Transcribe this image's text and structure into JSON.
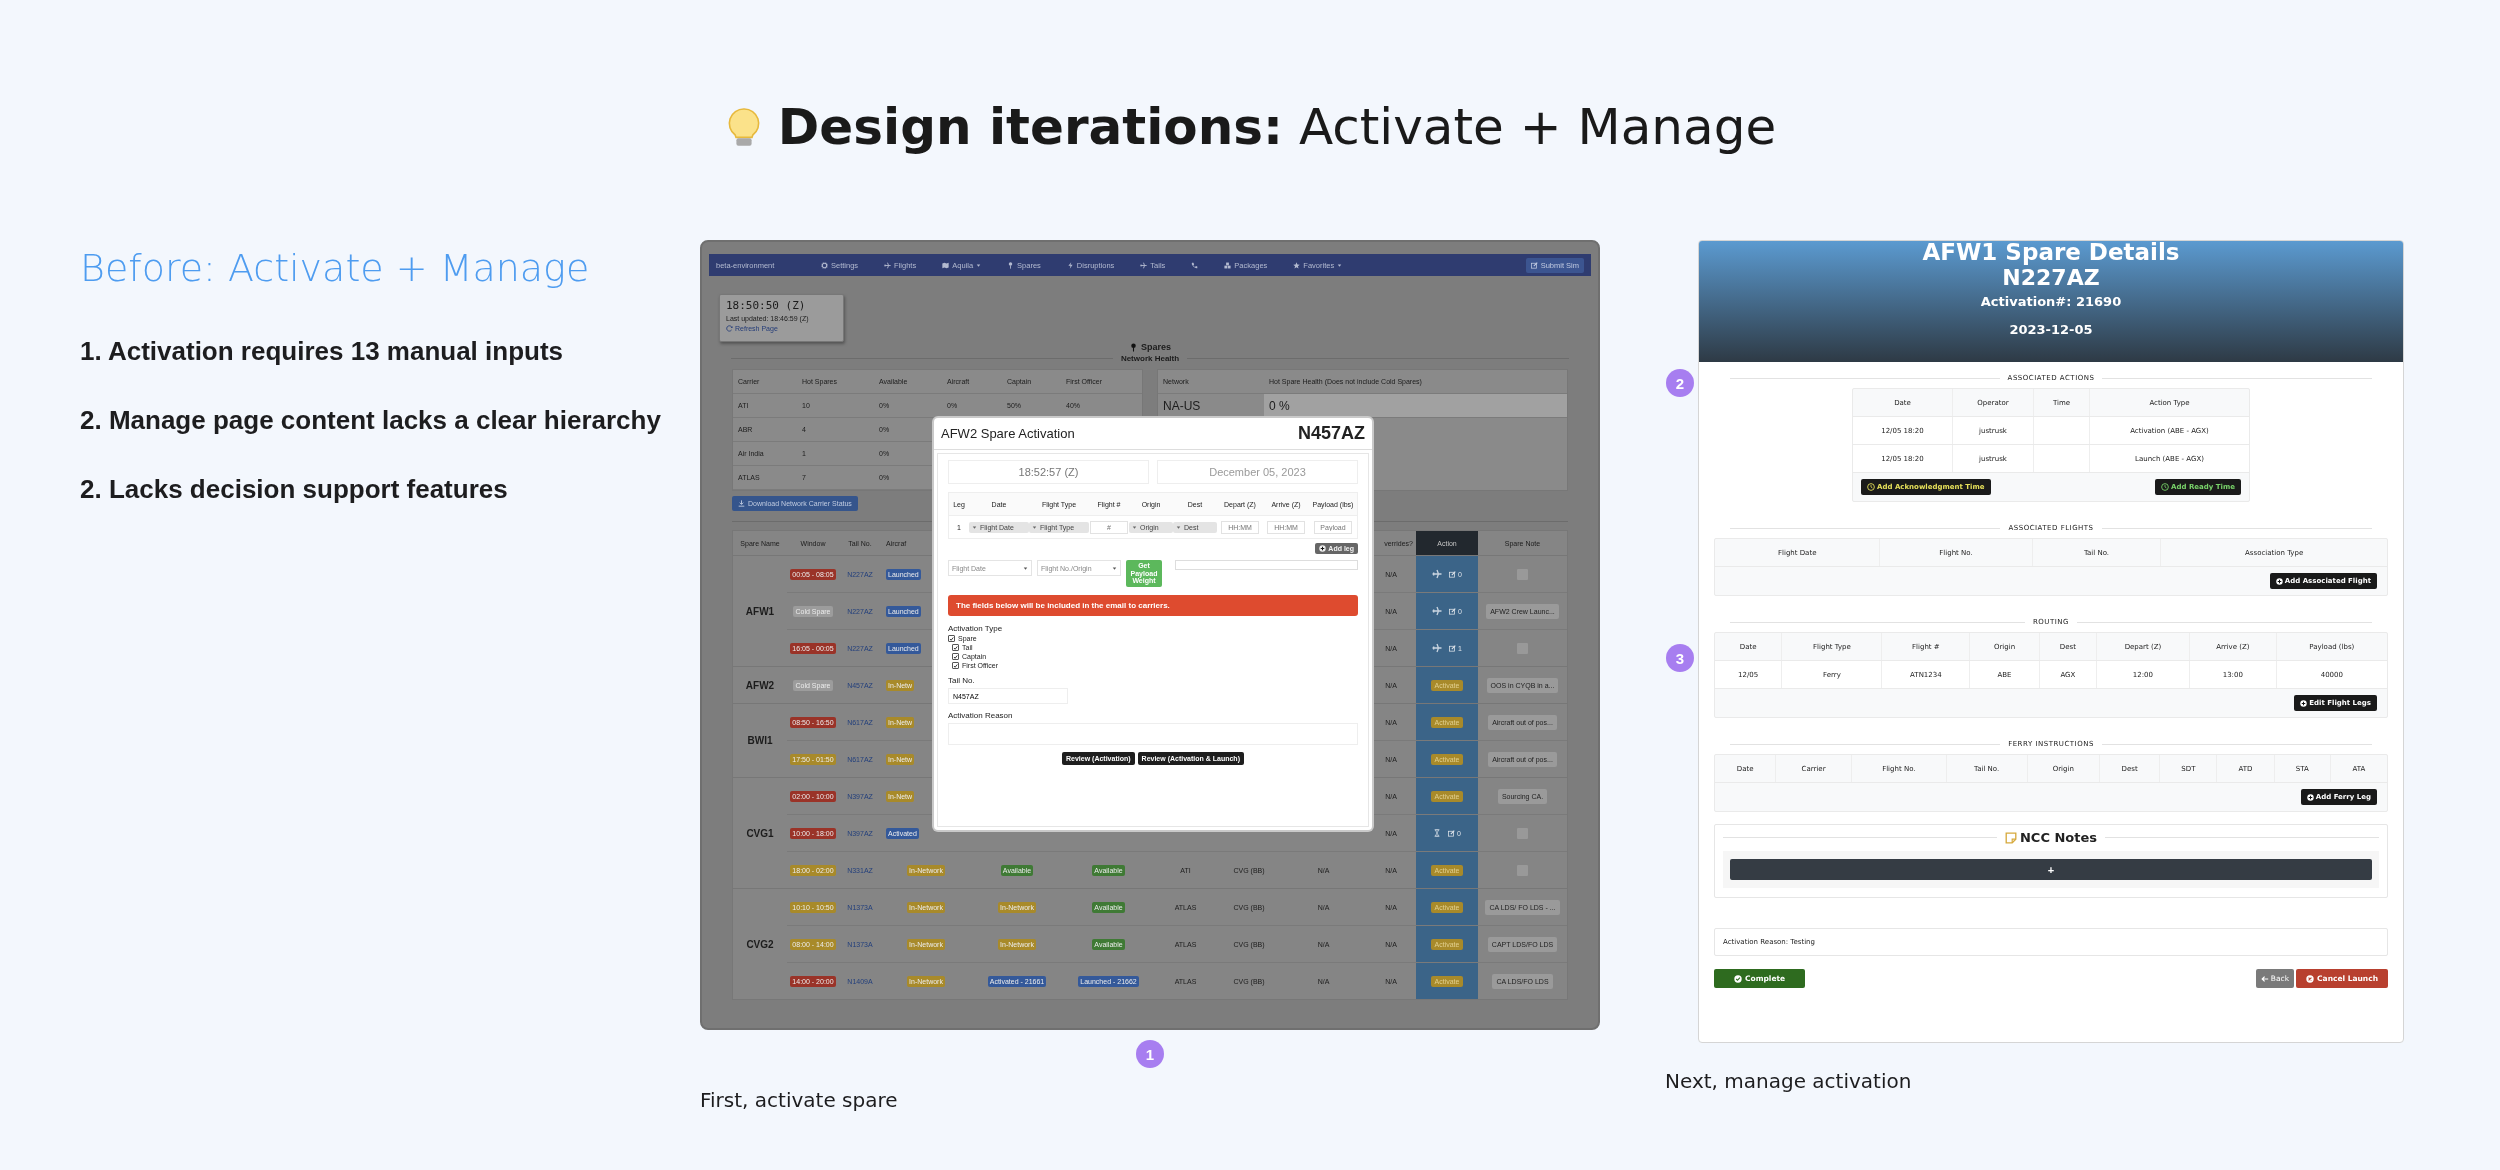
{
  "title": "**Design iterations:** Activate + Manage",
  "before": {
    "heading": "Before: Activate + Manage",
    "points": [
      "1. Activation requires 13 manual inputs",
      "2. Manage page content lacks a clear hierarchy",
      "2. Lacks decision support features"
    ]
  },
  "figure_1": {
    "badge": "1",
    "caption": "First, activate spare",
    "app": {
      "navbar": {
        "brand": "beta-environment",
        "items": [
          {
            "kind": "link",
            "label": "Settings"
          },
          {
            "kind": "link",
            "label": "Flights"
          },
          {
            "kind": "link",
            "label": "Aquila",
            "dropdown": true
          },
          {
            "kind": "link",
            "label": "Spares"
          },
          {
            "kind": "link",
            "label": "Disruptions"
          },
          {
            "kind": "link",
            "label": "Tails"
          },
          {
            "kind": "icon"
          },
          {
            "kind": "link",
            "label": "Packages"
          },
          {
            "kind": "link",
            "label": "Favorites",
            "dropdown": true
          }
        ],
        "submit": "Submit Sim"
      },
      "clock": {
        "time": "18:50:50 (Z)",
        "updated": "Last updated: 18:46:59 (Z)",
        "refresh": "Refresh Page"
      },
      "page_title": "Spares",
      "network_health": "Network Health",
      "carrier_table": {
        "columns": [
          "Carrier",
          "Hot Spares",
          "Available",
          "Aircraft",
          "Captain",
          "First Officer"
        ],
        "rows": [
          [
            "ATI",
            "10",
            "0%",
            "0%",
            "50%",
            "40%"
          ],
          [
            "ABR",
            "4",
            "0%"
          ],
          [
            "Air India",
            "1",
            "0%"
          ],
          [
            "ATLAS",
            "7",
            "0%"
          ]
        ]
      },
      "network_table": {
        "columns": [
          "Network",
          "Hot Spare Health"
        ],
        "note": "(Does not include Cold Spares)",
        "rows": [
          [
            "NA-US",
            "0 %"
          ]
        ]
      },
      "download_button": "Download Network Carrier Status",
      "spares_table": {
        "columns_left": [
          "Spare Name",
          "Window",
          "Tail No.",
          "Aircraf"
        ],
        "columns_right": [
          "verrides?",
          "Action",
          "Spare Note"
        ],
        "groups": [
          {
            "name": "AFW1",
            "rows": [
              {
                "window": {
                  "text": "00:05 - 08:05",
                  "color": "#9a3328"
                },
                "tail": "N227AZ",
                "aircraft": {
                  "text": "Launched",
                  "color": "#34599a"
                },
                "overrides": "N/A",
                "action": {
                  "kind": "plane",
                  "count": "0"
                },
                "note": {
                  "kind": "checkbox",
                  "checked": false
                }
              },
              {
                "window": {
                  "text": "Cold Spare",
                  "color": "#9c9c9c"
                },
                "tail": "N227AZ",
                "aircraft": {
                  "text": "Launched",
                  "color": "#34599a"
                },
                "overrides": "N/A",
                "action": {
                  "kind": "plane",
                  "count": "0"
                },
                "note": {
                  "kind": "text",
                  "text": "AFW2 Crew Launc..."
                }
              },
              {
                "window": {
                  "text": "16:05 - 00:05",
                  "color": "#9a3328"
                },
                "tail": "N227AZ",
                "aircraft": {
                  "text": "Launched",
                  "color": "#34599a"
                },
                "overrides": "N/A",
                "action": {
                  "kind": "plane",
                  "count": "1"
                },
                "note": {
                  "kind": "checkbox",
                  "checked": false
                }
              }
            ]
          },
          {
            "name": "AFW2",
            "rows": [
              {
                "window": {
                  "text": "Cold Spare",
                  "color": "#9c9c9c"
                },
                "tail": "N457AZ",
                "aircraft": {
                  "text": "In-Netw",
                  "color": "#a88a2a"
                },
                "overrides": "N/A",
                "action": {
                  "kind": "activate",
                  "label": "Activate"
                },
                "note": {
                  "kind": "text",
                  "text": "OOS in CYQB in a..."
                }
              }
            ]
          },
          {
            "name": "BWI1",
            "rows": [
              {
                "window": {
                  "text": "08:50 - 16:50",
                  "color": "#9a3328"
                },
                "tail": "N617AZ",
                "aircraft": {
                  "text": "In-Netw",
                  "color": "#a88a2a"
                },
                "overrides": "N/A",
                "action": {
                  "kind": "activate",
                  "label": "Activate"
                },
                "note": {
                  "kind": "text",
                  "text": "Aircraft out of pos..."
                }
              },
              {
                "window": {
                  "text": "17:50 - 01:50",
                  "color": "#a88a2a"
                },
                "tail": "N617AZ",
                "aircraft": {
                  "text": "In-Netw",
                  "color": "#a88a2a"
                },
                "overrides": "N/A",
                "action": {
                  "kind": "activate",
                  "label": "Activate"
                },
                "note": {
                  "kind": "text",
                  "text": "Aircraft out of pos..."
                }
              }
            ]
          },
          {
            "name": "CVG1",
            "rows": [
              {
                "window": {
                  "text": "02:00 - 10:00",
                  "color": "#9a3328"
                },
                "tail": "N397AZ",
                "aircraft": {
                  "text": "In-Netw",
                  "color": "#a88a2a"
                },
                "overrides": "N/A",
                "action": {
                  "kind": "activate",
                  "label": "Activate"
                },
                "note": {
                  "kind": "text",
                  "text": "Sourcing CA."
                }
              },
              {
                "window": {
                  "text": "10:00 - 18:00",
                  "color": "#9a3328"
                },
                "tail": "N397AZ",
                "aircraft": {
                  "text": "Activated",
                  "color": "#34599a"
                },
                "overrides": "N/A",
                "action": {
                  "kind": "pending",
                  "count": "0"
                },
                "note": {
                  "kind": "checkbox",
                  "checked": false
                }
              },
              {
                "window": {
                  "text": "18:00 - 02:00",
                  "color": "#a88a2a"
                },
                "tail": "N331AZ",
                "aircraft": {
                  "text": "In-Network",
                  "color": "#a88a2a"
                },
                "column_5": {
                  "text": "Available",
                  "color": "#3f7a35"
                },
                "column_6": {
                  "text": "Available",
                  "color": "#3f7a35"
                },
                "column_7": "ATI",
                "column_8": "CVG (BB)",
                "column_9": "N/A",
                "overrides": "N/A",
                "action": {
                  "kind": "activate",
                  "label": "Activate"
                },
                "note": {
                  "kind": "checkbox",
                  "checked": false
                }
              }
            ]
          },
          {
            "name": "CVG2",
            "rows": [
              {
                "window": {
                  "text": "10:10 - 10:50",
                  "color": "#a88a2a"
                },
                "tail": "N1373A",
                "aircraft": {
                  "text": "In-Network",
                  "color": "#a88a2a"
                },
                "column_5": {
                  "text": "In-Network",
                  "color": "#a88a2a"
                },
                "column_6": {
                  "text": "Available",
                  "color": "#3f7a35"
                },
                "column_7": "ATLAS",
                "column_8": "CVG (BB)",
                "column_9": "N/A",
                "overrides": "N/A",
                "action": {
                  "kind": "activate",
                  "label": "Activate"
                },
                "note": {
                  "kind": "text",
                  "text": "CA LDS/ FO LDS - ..."
                }
              },
              {
                "window": {
                  "text": "08:00 - 14:00",
                  "color": "#a88a2a"
                },
                "tail": "N1373A",
                "aircraft": {
                  "text": "In-Network",
                  "color": "#a88a2a"
                },
                "column_5": {
                  "text": "In-Network",
                  "color": "#a88a2a"
                },
                "column_6": {
                  "text": "Available",
                  "color": "#3f7a35"
                },
                "column_7": "ATLAS",
                "column_8": "CVG (BB)",
                "column_9": "N/A",
                "overrides": "N/A",
                "action": {
                  "kind": "activate",
                  "label": "Activate"
                },
                "note": {
                  "kind": "text",
                  "text": "CAPT LDS/FO LDS"
                }
              },
              {
                "window": {
                  "text": "14:00 - 20:00",
                  "color": "#9a3328"
                },
                "tail": "N1409A",
                "aircraft": {
                  "text": "In-Network",
                  "color": "#a88a2a"
                },
                "column_5": {
                  "text": "Activated - 21661",
                  "color": "#34599a"
                },
                "column_6": {
                  "text": "Launched - 21662",
                  "color": "#34599a"
                },
                "column_7": "ATLAS",
                "column_8": "CVG (BB)",
                "column_9": "N/A",
                "overrides": "N/A",
                "action": {
                  "kind": "activate",
                  "label": "Activate"
                },
                "note": {
                  "kind": "text",
                  "text": "CA LDS/FO LDS"
                }
              }
            ]
          }
        ]
      },
      "modal": {
        "title": "AFW2 Spare Activation",
        "tail": "N457AZ",
        "time": "18:52:57 (Z)",
        "date": "December 05, 2023",
        "leg_columns": [
          "Leg",
          "Date",
          "Flight Type",
          "Flight #",
          "Origin",
          "Dest",
          "Depart (Z)",
          "Arrive (Z)",
          "Payload (lbs)"
        ],
        "leg_row": {
          "leg": "1",
          "date": "Flight Date",
          "flight_type": "Flight Type",
          "flight_no": {
            "placeholder": "#"
          },
          "origin": "Origin",
          "dest": "Dest",
          "depart": {
            "placeholder": "HH:MM"
          },
          "arrive": {
            "placeholder": "HH:MM"
          },
          "payload": {
            "placeholder": "Payload"
          }
        },
        "add_leg": "Add leg",
        "flight_date": "Flight Date",
        "flight_origin": "Flight No./Origin",
        "payload_button": "Get Payload Weight",
        "alert": "The fields below will be included in the email to carriers.",
        "activation_type": {
          "label": "Activation Type",
          "options": [
            {
              "label": "Spare",
              "checked": true,
              "children": [
                {
                  "label": "Tail",
                  "checked": true
                },
                {
                  "label": "Captain",
                  "checked": true
                },
                {
                  "label": "First Officer",
                  "checked": true
                }
              ]
            }
          ]
        },
        "tail_label": "Tail No.",
        "tail_value": "N457AZ",
        "reason_label": "Activation Reason",
        "buttons": [
          "Review (Activation)",
          "Review (Activation & Launch)"
        ]
      }
    }
  },
  "figure_2": {
    "badges": [
      "2",
      "3"
    ],
    "caption": "Next, manage activation",
    "details": {
      "title": "AFW1 Spare Details",
      "tail": "N227AZ",
      "activation": "Activation#: 21690",
      "date": "2023-12-05",
      "actions": {
        "heading": "ASSOCIATED ACTIONS",
        "columns": [
          "Date",
          "Operator",
          "Time",
          "Action Type"
        ],
        "rows": [
          {
            "date": "12/05 18:20",
            "operator": "justrusk",
            "action_type": "Activation (ABE - AGX)"
          },
          {
            "date": "12/05 18:20",
            "operator": "justrusk",
            "action_type": "Launch (ABE - AGX)"
          }
        ],
        "ack_button": "Add Acknowledgment Time",
        "ready_button": "Add Ready Time"
      },
      "flights": {
        "heading": "ASSOCIATED FLIGHTS",
        "columns": [
          "Flight Date",
          "Flight No.",
          "Tail No.",
          "Association Type"
        ],
        "button": "Add Associated Flight"
      },
      "routing": {
        "heading": "ROUTING",
        "columns": [
          "Date",
          "Flight Type",
          "Flight #",
          "Origin",
          "Dest",
          "Depart (Z)",
          "Arrive (Z)",
          "Payload (lbs)"
        ],
        "rows": [
          [
            "12/05",
            "Ferry",
            "ATN1234",
            "ABE",
            "AGX",
            "12:00",
            "13:00",
            "40000"
          ]
        ],
        "button": "Edit Flight Legs"
      },
      "ferry": {
        "heading": "FERRY INSTRUCTIONS",
        "columns": [
          "Date",
          "Carrier",
          "Flight No.",
          "Tail No.",
          "Origin",
          "Dest",
          "SDT",
          "ATD",
          "STA",
          "ATA"
        ],
        "button": "Add Ferry Leg"
      },
      "notes": {
        "title": "NCC Notes",
        "add": "+"
      },
      "reason": "Activation Reason: Testing",
      "complete": "Complete",
      "back": "Back",
      "cancel": "Cancel Launch"
    }
  }
}
